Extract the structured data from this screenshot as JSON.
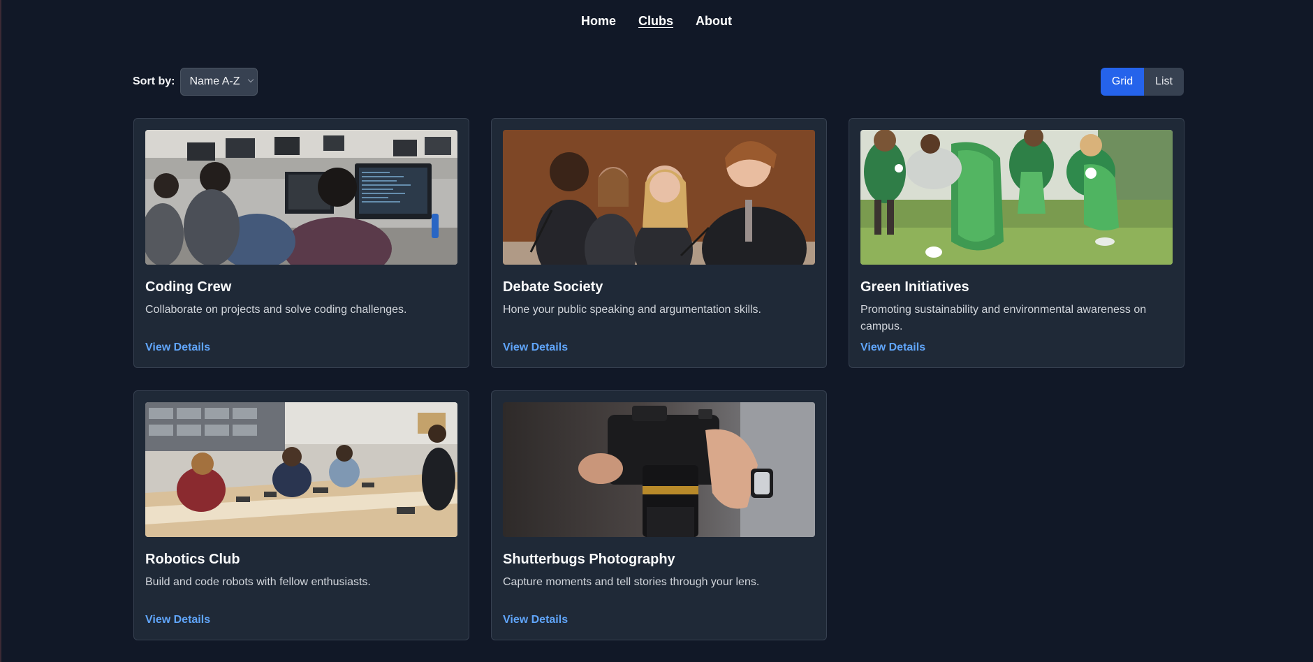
{
  "nav": {
    "items": [
      {
        "label": "Home"
      },
      {
        "label": "Clubs"
      },
      {
        "label": "About"
      }
    ]
  },
  "controls": {
    "sort_label": "Sort by:",
    "sort_value": "Name A-Z",
    "view_grid": "Grid",
    "view_list": "List"
  },
  "clubs": [
    {
      "name": "Coding Crew",
      "description": "Collaborate on projects and solve coding challenges.",
      "link": "View Details",
      "image": "computer-lab-photo"
    },
    {
      "name": "Debate Society",
      "description": "Hone your public speaking and argumentation skills.",
      "link": "View Details",
      "image": "debate-students-photo"
    },
    {
      "name": "Green Initiatives",
      "description": "Promoting sustainability and environmental awareness on campus.",
      "link": "View Details",
      "image": "cleanup-volunteers-photo"
    },
    {
      "name": "Robotics Club",
      "description": "Build and code robots with fellow enthusiasts.",
      "link": "View Details",
      "image": "robotics-lab-photo"
    },
    {
      "name": "Shutterbugs Photography",
      "description": "Capture moments and tell stories through your lens.",
      "link": "View Details",
      "image": "camera-hands-photo"
    }
  ]
}
